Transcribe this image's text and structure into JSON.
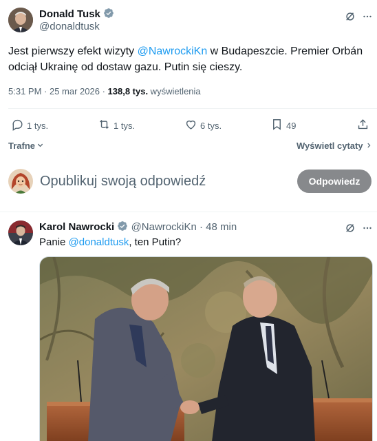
{
  "tweet": {
    "author_name": "Donald Tusk",
    "author_handle": "@donaldtusk",
    "text_before": "Jest pierwszy efekt wizyty ",
    "mention": "@NawrockiKn",
    "text_after": " w Budapeszcie. Premier Orbán odciął Ukrainę od dostaw gazu. Putin się cieszy.",
    "time": "5:31 PM · 25 mar 2026 · ",
    "views_count": "138,8 tys.",
    "views_label": " wyświetlenia",
    "stats": {
      "replies": "1 tys.",
      "reposts": "1 tys.",
      "likes": "6 tys.",
      "bookmarks": "49"
    }
  },
  "sort": {
    "label": "Trafne",
    "quotes_link": "Wyświetl cytaty"
  },
  "composer": {
    "placeholder": "Opublikuj swoją odpowiedź",
    "button": "Odpowiedz"
  },
  "reply": {
    "author_name": "Karol Nawrocki",
    "author_handle": "@NawrockiKn",
    "time": "48 min",
    "text_before": "Panie ",
    "mention": "@donaldtusk",
    "text_after": ", ten Putin?"
  },
  "colors": {
    "accent": "#1d9bf0",
    "verified": "#829aab",
    "button_bg": "#87898c",
    "muted": "#536471"
  },
  "icons": [
    "verified-badge-icon",
    "grok-icon",
    "reply-icon",
    "repost-icon",
    "like-icon",
    "bookmark-icon",
    "share-icon",
    "chevron-down-icon",
    "chevron-right-icon"
  ]
}
